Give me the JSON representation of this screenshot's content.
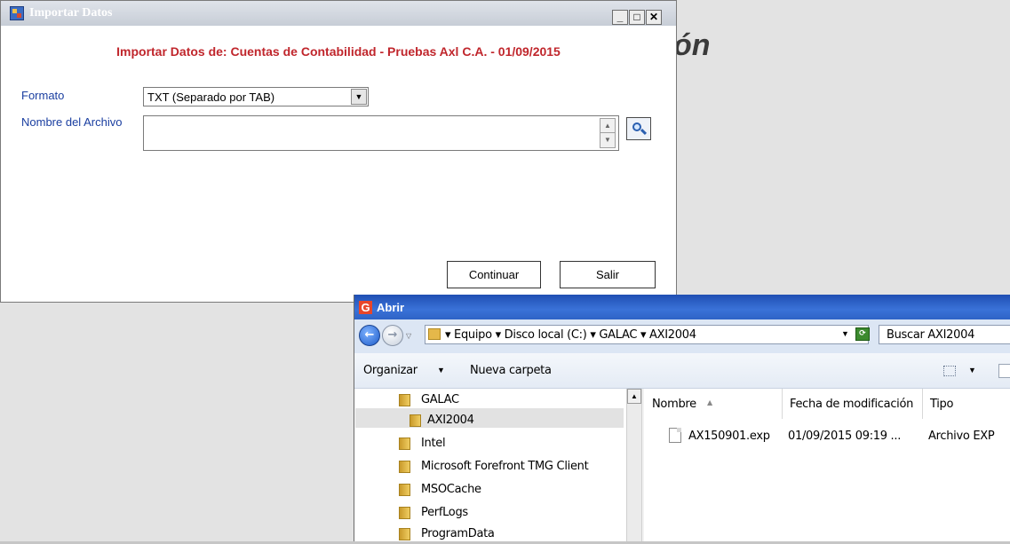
{
  "background": {
    "partial_text": "ón"
  },
  "import_window": {
    "title": "Importar Datos",
    "controls": {
      "minimize": "_",
      "maximize": "□",
      "close": "✕"
    },
    "heading": "Importar Datos de: Cuentas de Contabilidad - Pruebas Axl C.A. - 01/09/2015",
    "format_label": "Formato",
    "format_value": "TXT (Separado por TAB)",
    "file_label": "Nombre del Archivo",
    "file_value": "",
    "continue_label": "Continuar",
    "exit_label": "Salir",
    "heading_color": "#c0262c",
    "label_color": "#1a3ea0"
  },
  "open_dialog": {
    "title": "Abrir",
    "app_icon_letter": "G",
    "address": "▾ Equipo ▾ Disco local (C:) ▾ GALAC ▾ AXI2004",
    "search_placeholder": "Buscar AXI2004",
    "toolbar": {
      "organize": "Organizar",
      "new_folder": "Nueva carpeta"
    },
    "nav_items": [
      {
        "label": "GALAC"
      },
      {
        "label": "AXI2004",
        "selected": true
      },
      {
        "label": "Intel"
      },
      {
        "label": "Microsoft Forefront TMG Client"
      },
      {
        "label": "MSOCache"
      },
      {
        "label": "PerfLogs"
      },
      {
        "label": "ProgramData"
      }
    ],
    "columns": [
      "Nombre",
      "Fecha de modificación",
      "Tipo"
    ],
    "files": [
      {
        "name": "AX150901.exp",
        "modified": "01/09/2015 09:19 ...",
        "type": "Archivo EXP"
      }
    ]
  }
}
